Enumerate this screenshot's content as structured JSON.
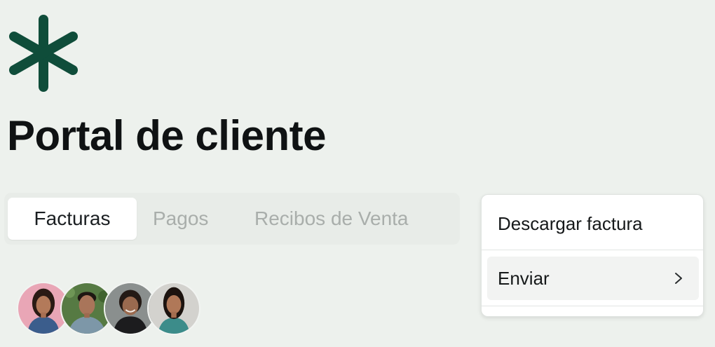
{
  "brand": {
    "logo_icon": "asterisk-icon",
    "color": "#0f4d3a"
  },
  "page": {
    "title": "Portal de cliente"
  },
  "tabs": [
    {
      "label": "Facturas",
      "active": true
    },
    {
      "label": "Pagos",
      "active": false
    },
    {
      "label": "Recibos de Venta",
      "active": false
    }
  ],
  "avatars": [
    {
      "icon": "person-photo-1"
    },
    {
      "icon": "person-photo-2"
    },
    {
      "icon": "person-photo-3"
    },
    {
      "icon": "person-photo-4"
    }
  ],
  "menu": {
    "download_label": "Descargar factura",
    "send_label": "Enviar",
    "send_submenu_icon": "chevron-right-icon"
  }
}
